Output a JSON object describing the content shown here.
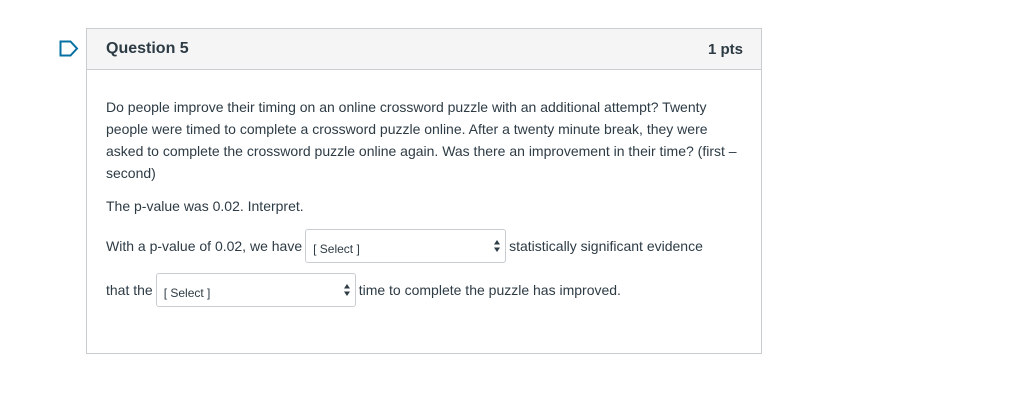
{
  "question": {
    "title": "Question 5",
    "points": "1 pts",
    "prompt": "Do people improve their timing on an online crossword puzzle with an additional attempt? Twenty people were timed to complete a crossword puzzle online. After a twenty minute break, they were asked to complete the crossword puzzle online again. Was there an improvement in their time? (first – second)",
    "pvalue_statement": "The p-value was 0.02. Interpret.",
    "line1_before": "With a p-value of 0.02, we have",
    "line1_after": "statistically significant evidence",
    "line2_before": "that the",
    "line2_after": "time to complete the puzzle has improved."
  },
  "dropdowns": {
    "evidence_select": "[ Select ]",
    "time_select": "[ Select ]"
  },
  "icons": {
    "flag": "flag-outline-icon",
    "select_arrows": "up-down-arrows-icon"
  },
  "colors": {
    "flag": "#0770a3",
    "text": "#2d3b45",
    "border": "#c7cdd1",
    "header_bg": "#f5f5f5"
  }
}
